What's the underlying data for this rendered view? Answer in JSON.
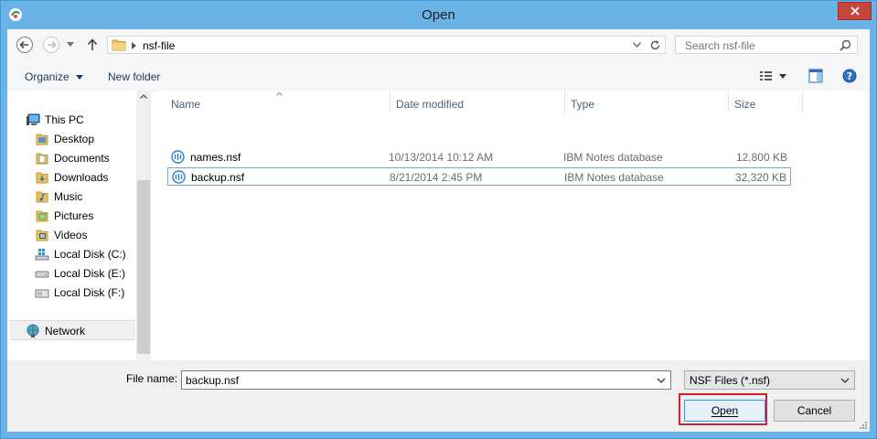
{
  "window": {
    "title": "Open"
  },
  "address": {
    "path": "nsf-file"
  },
  "search": {
    "placeholder": "Search nsf-file"
  },
  "toolbar": {
    "organize_label": "Organize",
    "new_folder_label": "New folder"
  },
  "nav": {
    "items": [
      {
        "label": "This PC",
        "icon": "computer-icon"
      },
      {
        "label": "Desktop",
        "icon": "folder-icon"
      },
      {
        "label": "Documents",
        "icon": "folder-icon"
      },
      {
        "label": "Downloads",
        "icon": "folder-icon"
      },
      {
        "label": "Music",
        "icon": "folder-icon"
      },
      {
        "label": "Pictures",
        "icon": "folder-icon"
      },
      {
        "label": "Videos",
        "icon": "folder-icon"
      },
      {
        "label": "Local Disk (C:)",
        "icon": "windows-drive-icon"
      },
      {
        "label": "Local Disk (E:)",
        "icon": "drive-icon"
      },
      {
        "label": "Local Disk (F:)",
        "icon": "drive-icon"
      },
      {
        "label": "Network",
        "icon": "network-icon"
      }
    ]
  },
  "files": {
    "columns": [
      "Name",
      "Date modified",
      "Type",
      "Size"
    ],
    "rows": [
      {
        "name": "names.nsf",
        "date": "10/13/2014 10:12 AM",
        "type": "IBM Notes database",
        "size": "12,800 KB"
      },
      {
        "name": "backup.nsf",
        "date": "8/21/2014 2:45 PM",
        "type": "IBM Notes database",
        "size": "32,320 KB"
      }
    ]
  },
  "footer": {
    "file_name_label": "File name:",
    "file_name_value": "backup.nsf",
    "filter_value": "NSF Files (*.nsf)",
    "open_label": "Open",
    "cancel_label": "Cancel"
  },
  "colors": {
    "title_bar": "#6ab3e6",
    "close_button": "#c7463c",
    "highlight_border": "#d3202c",
    "selection_border": "#7da2ce"
  }
}
